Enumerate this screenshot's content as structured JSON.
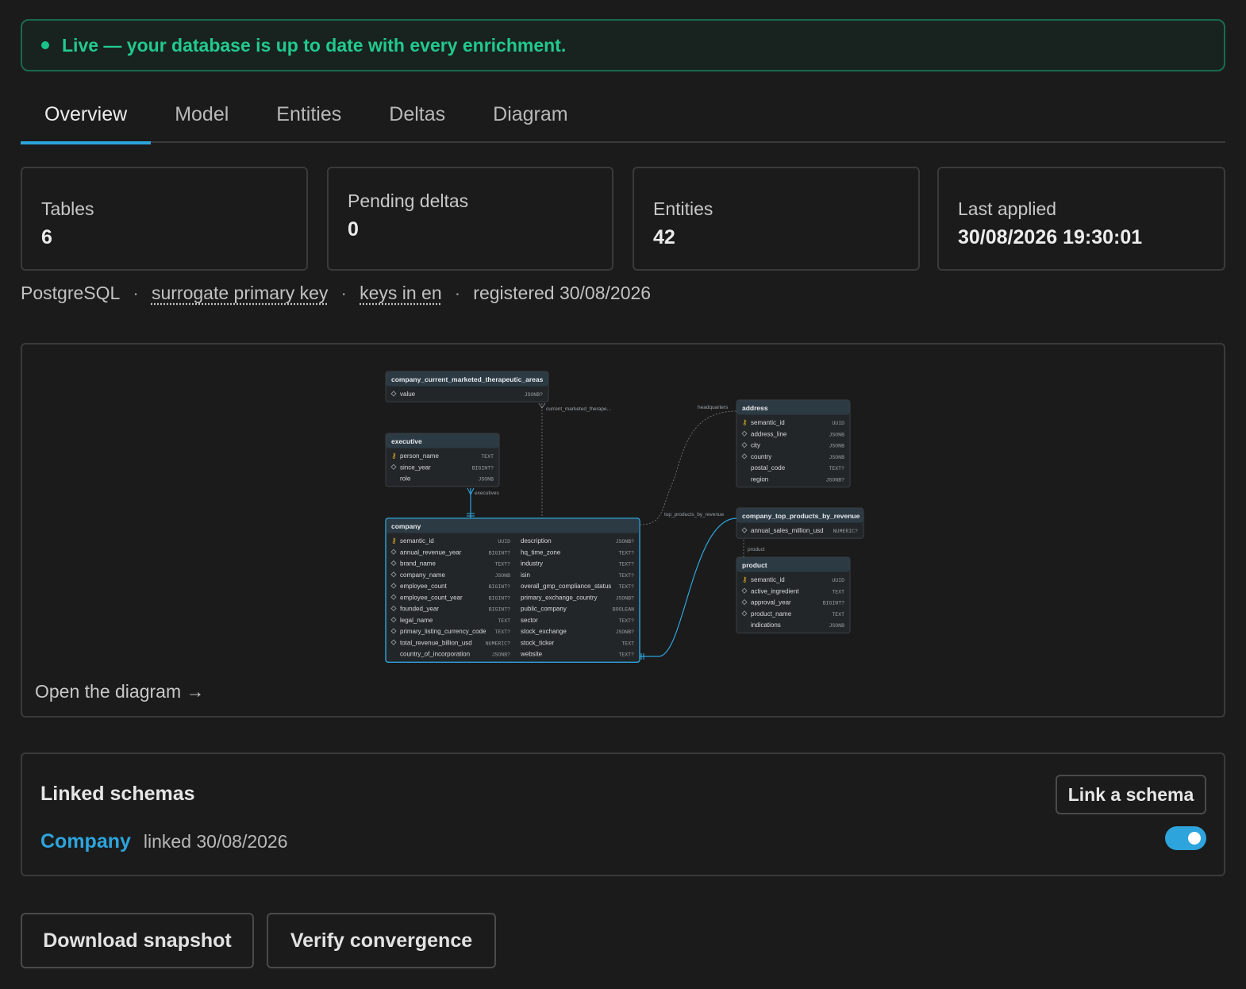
{
  "banner": {
    "text": "Live — your database is up to date with every enrichment."
  },
  "tabs": [
    {
      "label": "Overview",
      "active": true
    },
    {
      "label": "Model"
    },
    {
      "label": "Entities"
    },
    {
      "label": "Deltas"
    },
    {
      "label": "Diagram"
    }
  ],
  "stats": [
    {
      "label": "Tables",
      "value": "6"
    },
    {
      "label": "Pending deltas",
      "value": "0"
    },
    {
      "label": "Entities",
      "value": "42"
    },
    {
      "label": "Last applied",
      "value": "30/08/2026 19:30:01"
    }
  ],
  "meta": {
    "engine": "PostgreSQL",
    "key_strategy": "surrogate primary key",
    "key_language": "keys in en",
    "registered": "registered 30/08/2026",
    "separator": "·"
  },
  "diagram": {
    "open_label": "Open the diagram →",
    "tables": {
      "cta": {
        "name": "company_current_marketed_therapeutic_areas",
        "cols": [
          {
            "n": "value",
            "t": "JSONB?",
            "k": "fk"
          }
        ]
      },
      "executive": {
        "name": "executive",
        "cols": [
          {
            "n": "person_name",
            "t": "TEXT",
            "k": "pk"
          },
          {
            "n": "since_year",
            "t": "BIGINT?",
            "k": "fk"
          },
          {
            "n": "role",
            "t": "JSONB",
            "k": ""
          }
        ]
      },
      "address": {
        "name": "address",
        "cols": [
          {
            "n": "semantic_id",
            "t": "UUID",
            "k": "pk"
          },
          {
            "n": "address_line",
            "t": "JSONB",
            "k": "fk"
          },
          {
            "n": "city",
            "t": "JSONB",
            "k": "fk"
          },
          {
            "n": "country",
            "t": "JSONB",
            "k": "fk"
          },
          {
            "n": "postal_code",
            "t": "TEXT?",
            "k": ""
          },
          {
            "n": "region",
            "t": "JSONB?",
            "k": ""
          }
        ]
      },
      "top": {
        "name": "company_top_products_by_revenue",
        "cols": [
          {
            "n": "annual_sales_million_usd",
            "t": "NUMERIC?",
            "k": "fk"
          }
        ]
      },
      "product": {
        "name": "product",
        "cols": [
          {
            "n": "semantic_id",
            "t": "UUID",
            "k": "pk"
          },
          {
            "n": "active_ingredient",
            "t": "TEXT",
            "k": "fk"
          },
          {
            "n": "approval_year",
            "t": "BIGINT?",
            "k": "fk"
          },
          {
            "n": "product_name",
            "t": "TEXT",
            "k": "fk"
          },
          {
            "n": "indications",
            "t": "JSONB",
            "k": ""
          }
        ]
      },
      "company": {
        "name": "company",
        "left": [
          {
            "n": "semantic_id",
            "t": "UUID",
            "k": "pk"
          },
          {
            "n": "annual_revenue_year",
            "t": "BIGINT?",
            "k": "fk"
          },
          {
            "n": "brand_name",
            "t": "TEXT?",
            "k": "fk"
          },
          {
            "n": "company_name",
            "t": "JSONB",
            "k": "fk"
          },
          {
            "n": "employee_count",
            "t": "BIGINT?",
            "k": "fk"
          },
          {
            "n": "employee_count_year",
            "t": "BIGINT?",
            "k": "fk"
          },
          {
            "n": "founded_year",
            "t": "BIGINT?",
            "k": "fk"
          },
          {
            "n": "legal_name",
            "t": "TEXT",
            "k": "fk"
          },
          {
            "n": "primary_listing_currency_code",
            "t": "TEXT?",
            "k": "fk"
          },
          {
            "n": "total_revenue_billion_usd",
            "t": "NUMERIC?",
            "k": "fk"
          },
          {
            "n": "country_of_incorporation",
            "t": "JSONB?",
            "k": ""
          }
        ],
        "right": [
          {
            "n": "description",
            "t": "JSONB?"
          },
          {
            "n": "hq_time_zone",
            "t": "TEXT?"
          },
          {
            "n": "industry",
            "t": "TEXT?"
          },
          {
            "n": "isin",
            "t": "TEXT?"
          },
          {
            "n": "overall_gmp_compliance_status",
            "t": "TEXT?"
          },
          {
            "n": "primary_exchange_country",
            "t": "JSONB?"
          },
          {
            "n": "public_company",
            "t": "BOOLEAN"
          },
          {
            "n": "sector",
            "t": "TEXT?"
          },
          {
            "n": "stock_exchange",
            "t": "JSONB?"
          },
          {
            "n": "stock_ticker",
            "t": "TEXT"
          },
          {
            "n": "website",
            "t": "TEXT?"
          }
        ]
      }
    },
    "edge_labels": {
      "current": "current_marketed_therape...",
      "headquarters": "headquarters",
      "executives": "executives",
      "top_products": "top_products_by_revenue",
      "product": "product"
    }
  },
  "linked": {
    "title": "Linked schemas",
    "link_button": "Link a schema",
    "items": [
      {
        "name": "Company",
        "date": "linked 30/08/2026",
        "enabled": true
      }
    ]
  },
  "actions": {
    "download": "Download snapshot",
    "verify": "Verify convergence"
  },
  "colors": {
    "accent": "#2ea4dc",
    "live": "#22c98f",
    "pk_icon": "#e0b020"
  }
}
